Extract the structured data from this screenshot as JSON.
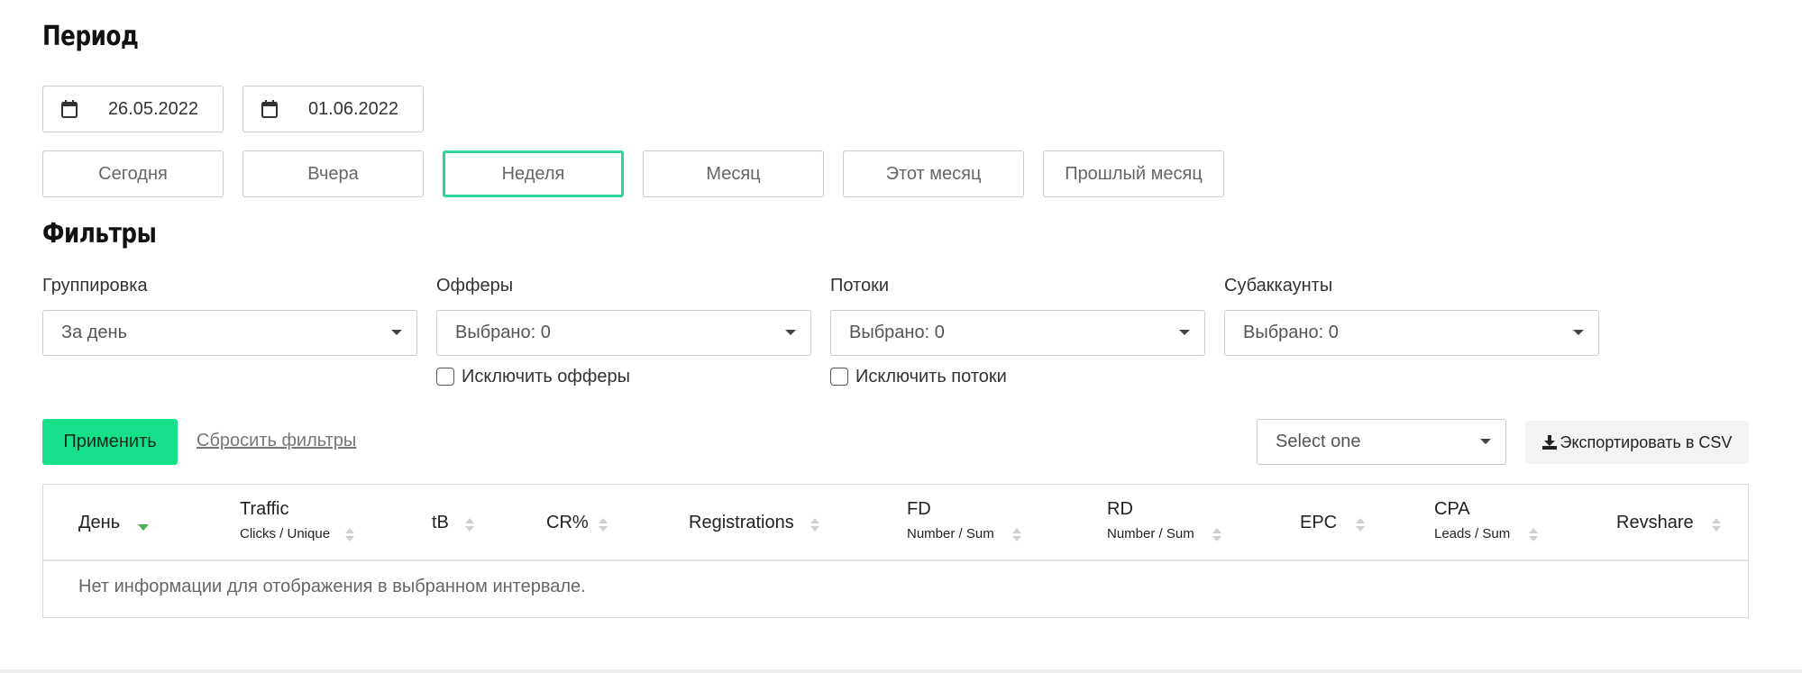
{
  "period": {
    "title": "Период",
    "date_from": "26.05.2022",
    "date_to": "01.06.2022",
    "presets": [
      "Сегодня",
      "Вчера",
      "Неделя",
      "Месяц",
      "Этот месяц",
      "Прошлый месяц"
    ],
    "active_preset": "Неделя"
  },
  "filters": {
    "title": "Фильтры",
    "grouping": {
      "label": "Группировка",
      "value": "За день"
    },
    "offers": {
      "label": "Офферы",
      "value": "Выбрано: 0",
      "exclude_label": "Исключить офферы"
    },
    "streams": {
      "label": "Потоки",
      "value": "Выбрано: 0",
      "exclude_label": "Исключить потоки"
    },
    "subaccounts": {
      "label": "Субаккаунты",
      "value": "Выбрано: 0"
    }
  },
  "actions": {
    "apply_label": "Применить",
    "reset_label": "Сбросить фильтры",
    "select_placeholder": "Select one",
    "export_label": "Экспортировать в CSV"
  },
  "table": {
    "columns": [
      {
        "label": "День",
        "sub": ""
      },
      {
        "label": "Traffic",
        "sub": "Clicks / Unique"
      },
      {
        "label": "tB",
        "sub": ""
      },
      {
        "label": "CR%",
        "sub": ""
      },
      {
        "label": "Registrations",
        "sub": ""
      },
      {
        "label": "FD",
        "sub": "Number / Sum"
      },
      {
        "label": "RD",
        "sub": "Number / Sum"
      },
      {
        "label": "EPC",
        "sub": ""
      },
      {
        "label": "CPA",
        "sub": "Leads / Sum"
      },
      {
        "label": "Revshare",
        "sub": ""
      }
    ],
    "empty_message": "Нет информации для отображения в выбранном интервале."
  },
  "colors": {
    "accent_green": "#17e08a",
    "active_border": "#2fd59a",
    "sort_active": "#4caf50"
  }
}
